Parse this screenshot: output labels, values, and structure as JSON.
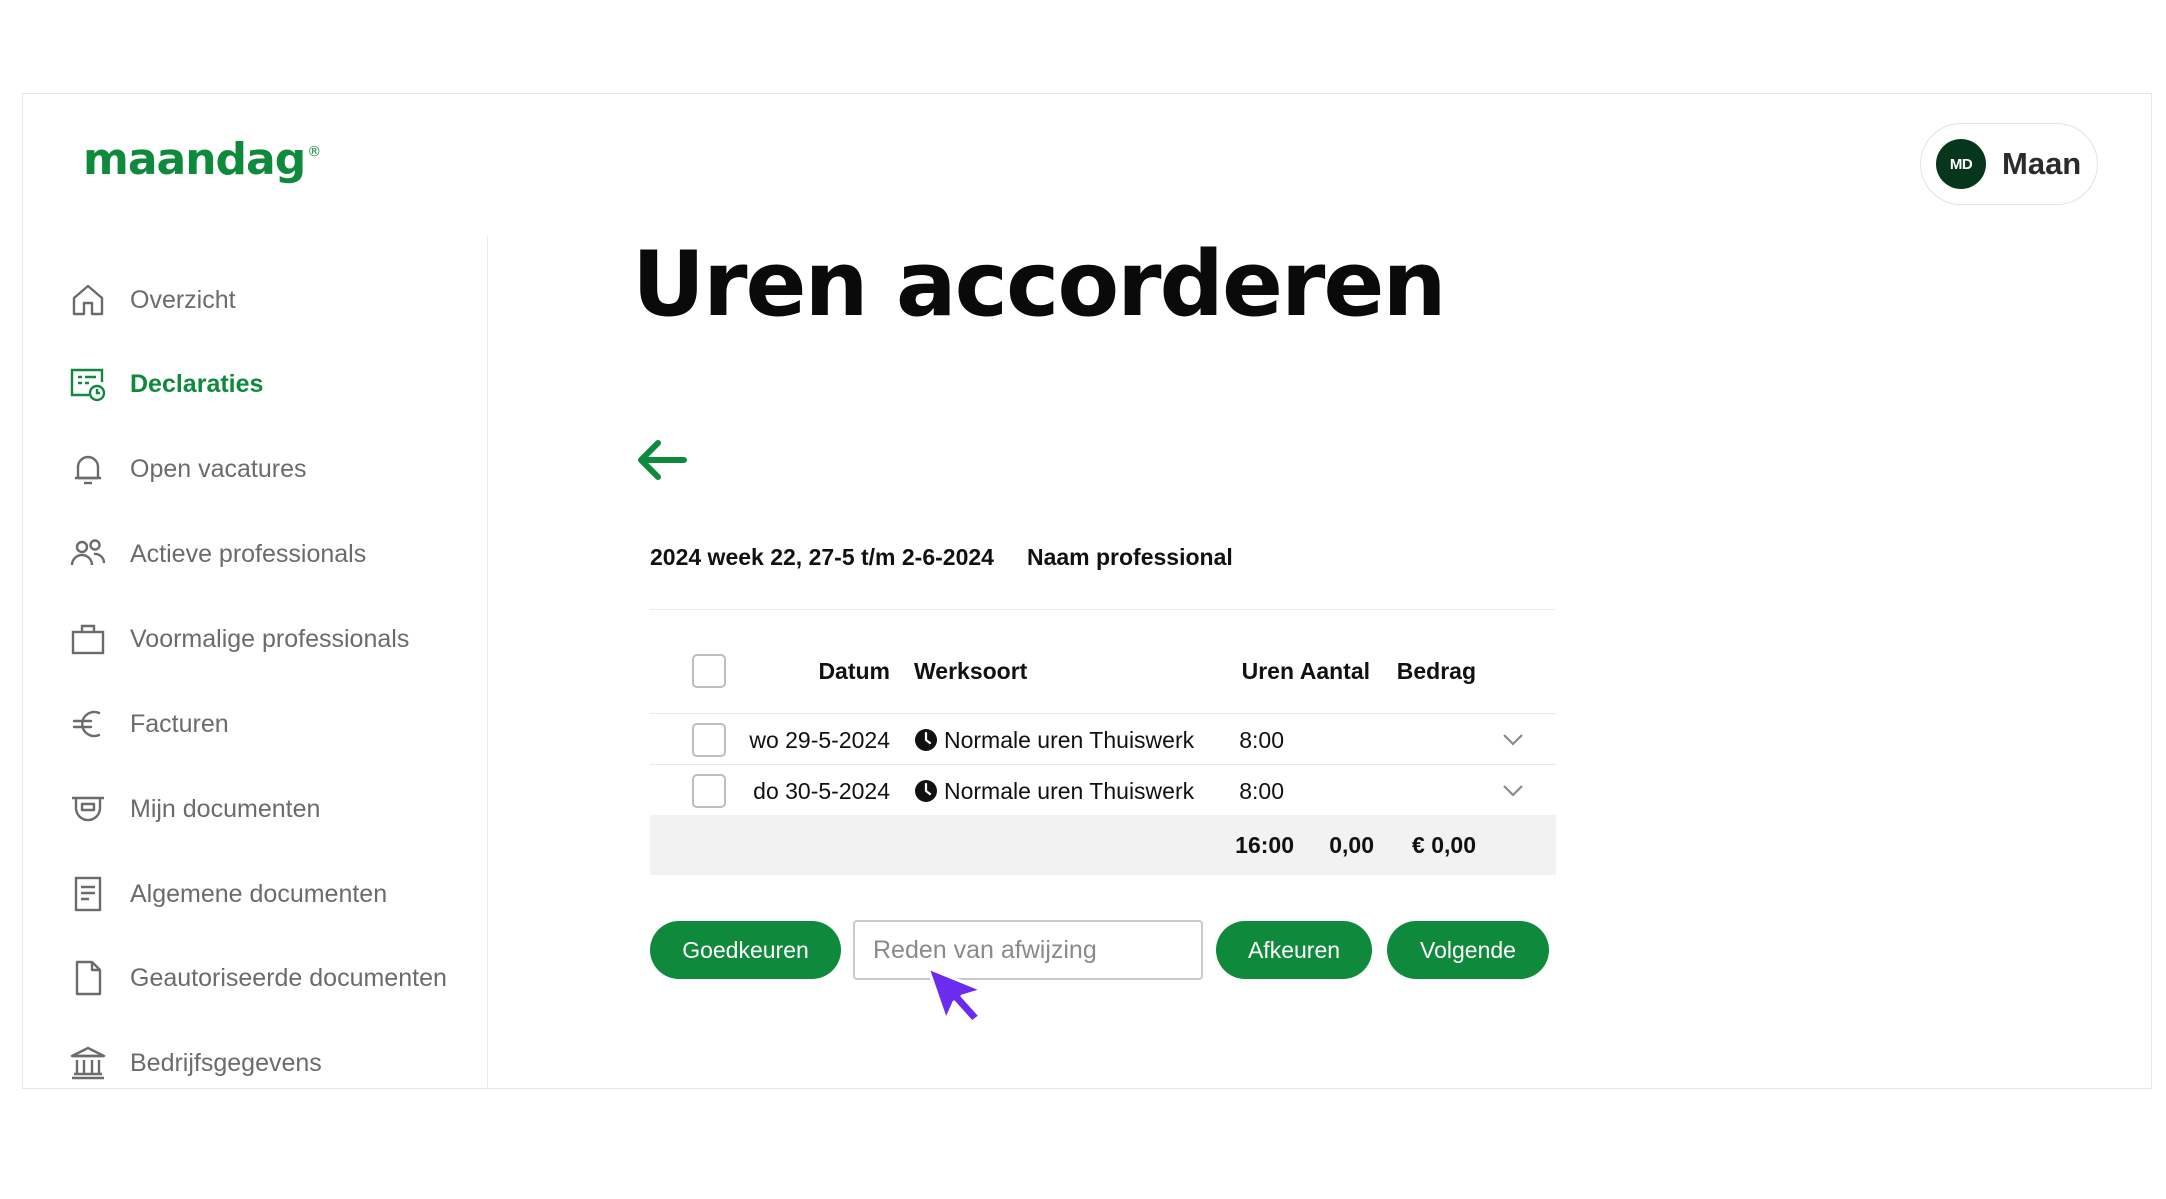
{
  "brand": {
    "logo_text": "maandag",
    "registered_mark": "®",
    "accent_color": "#0f8a3c"
  },
  "user": {
    "initials": "MD",
    "name": "Maan"
  },
  "sidebar": {
    "items": [
      {
        "label": "Overzicht",
        "icon": "home-icon",
        "active": false
      },
      {
        "label": "Declaraties",
        "icon": "timesheet-clock-icon",
        "active": true
      },
      {
        "label": "Open vacatures",
        "icon": "bell-icon",
        "active": false
      },
      {
        "label": "Actieve professionals",
        "icon": "people-icon",
        "active": false
      },
      {
        "label": "Voormalige professionals",
        "icon": "briefcase-icon",
        "active": false
      },
      {
        "label": "Facturen",
        "icon": "euro-icon",
        "active": false
      },
      {
        "label": "Mijn documenten",
        "icon": "document-tray-icon",
        "active": false
      },
      {
        "label": "Algemene documenten",
        "icon": "document-lines-icon",
        "active": false
      },
      {
        "label": "Geautoriseerde documenten",
        "icon": "document-icon",
        "active": false
      },
      {
        "label": "Bedrijfsgegevens",
        "icon": "building-icon",
        "active": false
      }
    ]
  },
  "main": {
    "title": "Uren accorderen",
    "period": "2024 week 22, 27-5 t/m 2-6-2024",
    "professional": "Naam professional",
    "table": {
      "headers": {
        "datum": "Datum",
        "werksoort": "Werksoort",
        "uren": "Uren",
        "aantal": "Aantal",
        "bedrag": "Bedrag"
      },
      "rows": [
        {
          "datum": "wo 29-5-2024",
          "werksoort": "Normale uren Thuiswerk",
          "uren": "8:00"
        },
        {
          "datum": "do 30-5-2024",
          "werksoort": "Normale uren Thuiswerk",
          "uren": "8:00"
        }
      ],
      "totals": {
        "uren": "16:00",
        "aantal": "0,00",
        "bedrag": "€ 0,00"
      }
    },
    "actions": {
      "approve_label": "Goedkeuren",
      "reason_placeholder": "Reden van afwijzing",
      "reject_label": "Afkeuren",
      "next_label": "Volgende"
    }
  }
}
